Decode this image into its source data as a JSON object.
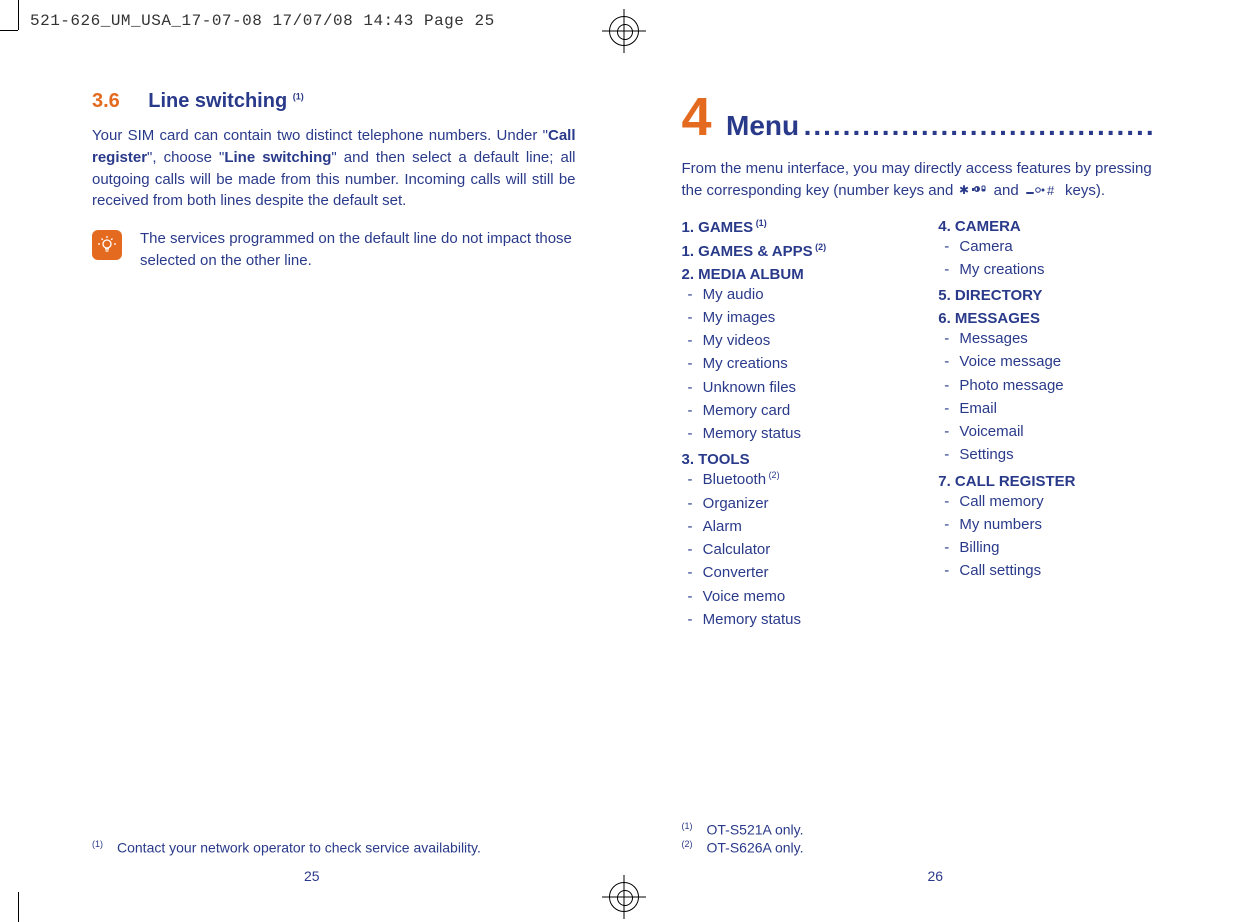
{
  "print_header": "521-626_UM_USA_17-07-08  17/07/08  14:43  Page 25",
  "left": {
    "section_num": "3.6",
    "section_title": "Line switching",
    "section_title_sup": "(1)",
    "para_parts": {
      "a": "Your SIM card can contain two distinct telephone numbers. Under \"",
      "b": "Call register",
      "c": "\", choose \"",
      "d": "Line switching",
      "e": "\" and then select a default line; all outgoing calls will be made from this number. Incoming calls will still be received from both lines despite the default set."
    },
    "tip": "The services programmed on the default line do not impact those selected on the other line.",
    "footnote_mark": "(1)",
    "footnote_text": "Contact your network operator to check service availability.",
    "page_number": "25"
  },
  "right": {
    "chapter_num": "4",
    "chapter_title": "Menu",
    "dots": "......................................",
    "intro_a": "From the menu interface, you may directly access features by pressing the corresponding key (number keys and ",
    "intro_b": " and ",
    "intro_c": " keys).",
    "col1": [
      {
        "type": "head",
        "text": "1. GAMES",
        "sup": "(1)"
      },
      {
        "type": "head",
        "text": "1. GAMES & APPS",
        "sup": "(2)"
      },
      {
        "type": "head",
        "text": "2. MEDIA ALBUM"
      },
      {
        "type": "item",
        "text": "My audio"
      },
      {
        "type": "item",
        "text": "My images"
      },
      {
        "type": "item",
        "text": "My videos"
      },
      {
        "type": "item",
        "text": "My creations"
      },
      {
        "type": "item",
        "text": "Unknown files"
      },
      {
        "type": "item",
        "text": "Memory card"
      },
      {
        "type": "item",
        "text": "Memory status"
      },
      {
        "type": "head",
        "text": "3. TOOLS"
      },
      {
        "type": "item",
        "text": "Bluetooth",
        "sup": "(2)"
      },
      {
        "type": "item",
        "text": "Organizer"
      },
      {
        "type": "item",
        "text": "Alarm"
      },
      {
        "type": "item",
        "text": "Calculator"
      },
      {
        "type": "item",
        "text": "Converter"
      },
      {
        "type": "item",
        "text": "Voice memo"
      },
      {
        "type": "item",
        "text": "Memory status"
      }
    ],
    "col2": [
      {
        "type": "head",
        "text": "4. CAMERA"
      },
      {
        "type": "item",
        "text": "Camera"
      },
      {
        "type": "item",
        "text": "My creations"
      },
      {
        "type": "head",
        "text": "5. DIRECTORY"
      },
      {
        "type": "head",
        "text": "6. MESSAGES"
      },
      {
        "type": "item",
        "text": "Messages"
      },
      {
        "type": "item",
        "text": "Voice message"
      },
      {
        "type": "item",
        "text": "Photo message"
      },
      {
        "type": "item",
        "text": "Email"
      },
      {
        "type": "item",
        "text": "Voicemail"
      },
      {
        "type": "item",
        "text": "Settings"
      },
      {
        "type": "head",
        "text": "7. CALL REGISTER"
      },
      {
        "type": "item",
        "text": "Call memory"
      },
      {
        "type": "item",
        "text": "My numbers"
      },
      {
        "type": "item",
        "text": "Billing"
      },
      {
        "type": "item",
        "text": "Call settings"
      }
    ],
    "footnotes": [
      {
        "mark": "(1)",
        "text": "OT-S521A only."
      },
      {
        "mark": "(2)",
        "text": "OT-S626A only."
      }
    ],
    "page_number": "26"
  }
}
